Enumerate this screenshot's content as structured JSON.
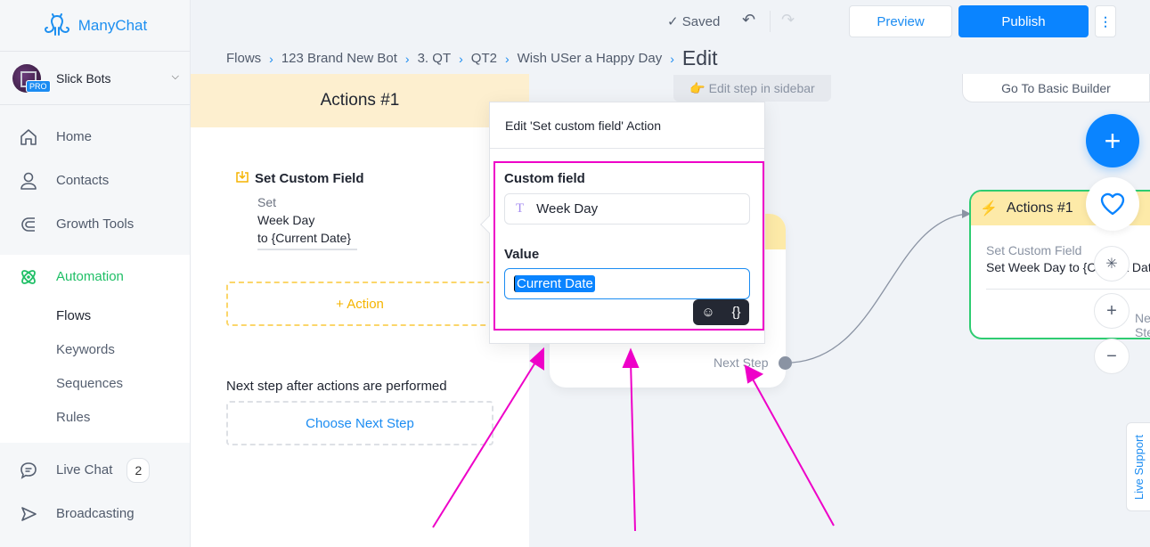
{
  "app": {
    "brand": "ManyChat"
  },
  "account": {
    "name": "Slick Bots",
    "badge": "PRO"
  },
  "sidebar": {
    "items": [
      {
        "label": "Home",
        "icon": "home-icon"
      },
      {
        "label": "Contacts",
        "icon": "user-icon"
      },
      {
        "label": "Growth Tools",
        "icon": "magnet-icon"
      }
    ],
    "automation": {
      "label": "Automation",
      "icon": "atom-icon",
      "subitems": [
        "Flows",
        "Keywords",
        "Sequences",
        "Rules"
      ],
      "current": "Flows"
    },
    "bottom_items": [
      {
        "label": "Live Chat",
        "icon": "chat-icon",
        "count": "2"
      },
      {
        "label": "Broadcasting",
        "icon": "send-icon"
      }
    ]
  },
  "topbar": {
    "status": "Saved",
    "preview_label": "Preview",
    "publish_label": "Publish",
    "more_label": "⋮"
  },
  "breadcrumb": {
    "items": [
      "Flows",
      "123 Brand New Bot",
      "3. QT",
      "QT2",
      "Wish USer a Happy Day"
    ],
    "current": "Edit"
  },
  "editor": {
    "title": "Actions #1",
    "action": {
      "title": "Set Custom Field",
      "line1": "Set",
      "field": "Week Day",
      "value_line": "to {Current Date}"
    },
    "add_action_label": "+ Action",
    "next_step_label": "Next step after actions are performed",
    "choose_next_label": "Choose Next Step"
  },
  "canvas": {
    "edit_hint": "👉 Edit step in sidebar",
    "basic_builder_label": "Go To Basic Builder",
    "next_step_label": "Next Step",
    "right_node": {
      "title": "Actions #1",
      "subtitle": "Set Custom Field",
      "value": "Set Week Day to {Current Date}",
      "next_label": "Next Step"
    },
    "live_support_label": "Live Support"
  },
  "popup": {
    "title": "Edit 'Set custom field' Action",
    "custom_field_label": "Custom field",
    "custom_field_value": "Week Day",
    "value_label": "Value",
    "value_text": "Current Date"
  },
  "colors": {
    "accent": "#0a84ff",
    "active_nav": "#1fbf66",
    "annotation": "#ee00c8",
    "node_border": "#2ecc71"
  }
}
